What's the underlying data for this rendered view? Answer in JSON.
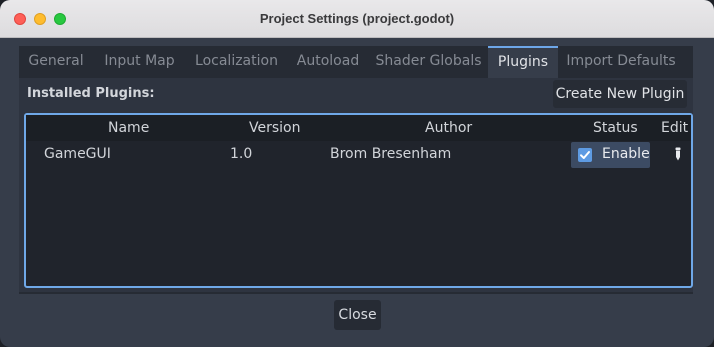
{
  "window": {
    "title": "Project Settings (project.godot)"
  },
  "tabs": [
    {
      "label": "General"
    },
    {
      "label": "Input Map"
    },
    {
      "label": "Localization"
    },
    {
      "label": "Autoload"
    },
    {
      "label": "Shader Globals"
    },
    {
      "label": "Plugins",
      "active": true
    },
    {
      "label": "Import Defaults"
    }
  ],
  "plugins_section": {
    "label": "Installed Plugins:",
    "create_button": "Create New Plugin",
    "columns": [
      "Name",
      "Version",
      "Author",
      "Status",
      "Edit"
    ],
    "rows": [
      {
        "name": "GameGUI",
        "version": "1.0",
        "author": "Brom Bresenham",
        "status_label": "Enable",
        "enabled": true,
        "edit_icon": "pencil-icon"
      }
    ]
  },
  "footer": {
    "close_button": "Close"
  },
  "colors": {
    "accent": "#6fa8e8",
    "checkbox": "#5e9be3",
    "window_bg": "#363d4a"
  }
}
